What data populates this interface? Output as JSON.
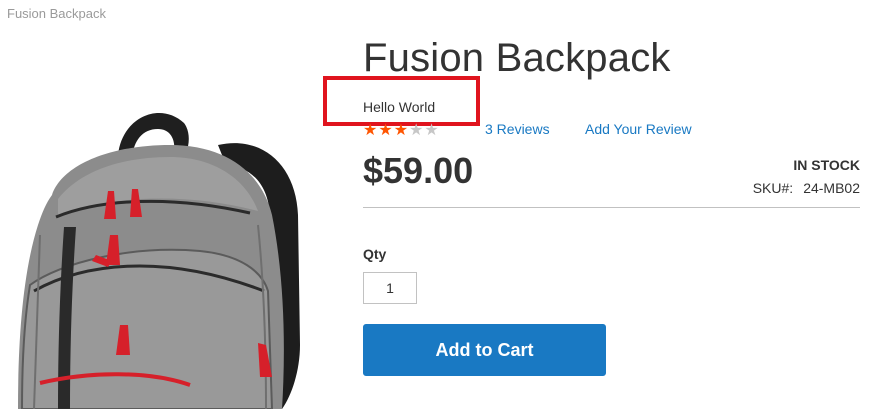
{
  "breadcrumb": {
    "current": "Fusion Backpack"
  },
  "product": {
    "name": "Fusion Backpack",
    "custom_text": "Hello World",
    "rating_stars_filled": 3,
    "rating_stars_total": 5,
    "reviews_link": "3 Reviews",
    "add_review_link": "Add Your Review",
    "price": "$59.00",
    "stock_status": "In stock",
    "sku_label": "SKU#:",
    "sku_value": "24-MB02",
    "image_icon": "backpack-image"
  },
  "purchase": {
    "qty_label": "Qty",
    "qty_value": "1",
    "add_to_cart_label": "Add to Cart"
  },
  "colors": {
    "accent_blue": "#1979c3",
    "star_filled": "#ff5501",
    "star_empty": "#c7c7c7",
    "highlight_red": "#e0141e"
  }
}
